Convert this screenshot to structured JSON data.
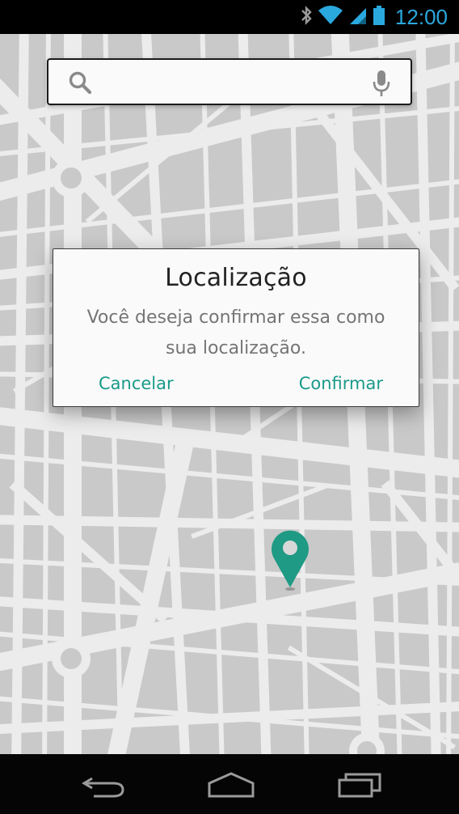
{
  "status_bar": {
    "time": "12:00",
    "icons": [
      "bluetooth-icon",
      "wifi-icon",
      "cell-signal-icon",
      "battery-icon"
    ],
    "time_color": "#2aa9df"
  },
  "search": {
    "placeholder": "",
    "value": "",
    "icons": [
      "search-icon",
      "microphone-icon"
    ]
  },
  "dialog": {
    "title": "Localização",
    "message": "Você deseja confirmar essa como sua localização.",
    "cancel_label": "Cancelar",
    "confirm_label": "Confirmar",
    "accent_color": "#1a9a8a"
  },
  "map": {
    "marker_color": "#1f9a84",
    "background_color": "#c9c9c9",
    "road_color": "#ececec"
  },
  "nav_bar": {
    "buttons": [
      "back-icon",
      "home-icon",
      "recent-apps-icon"
    ]
  }
}
